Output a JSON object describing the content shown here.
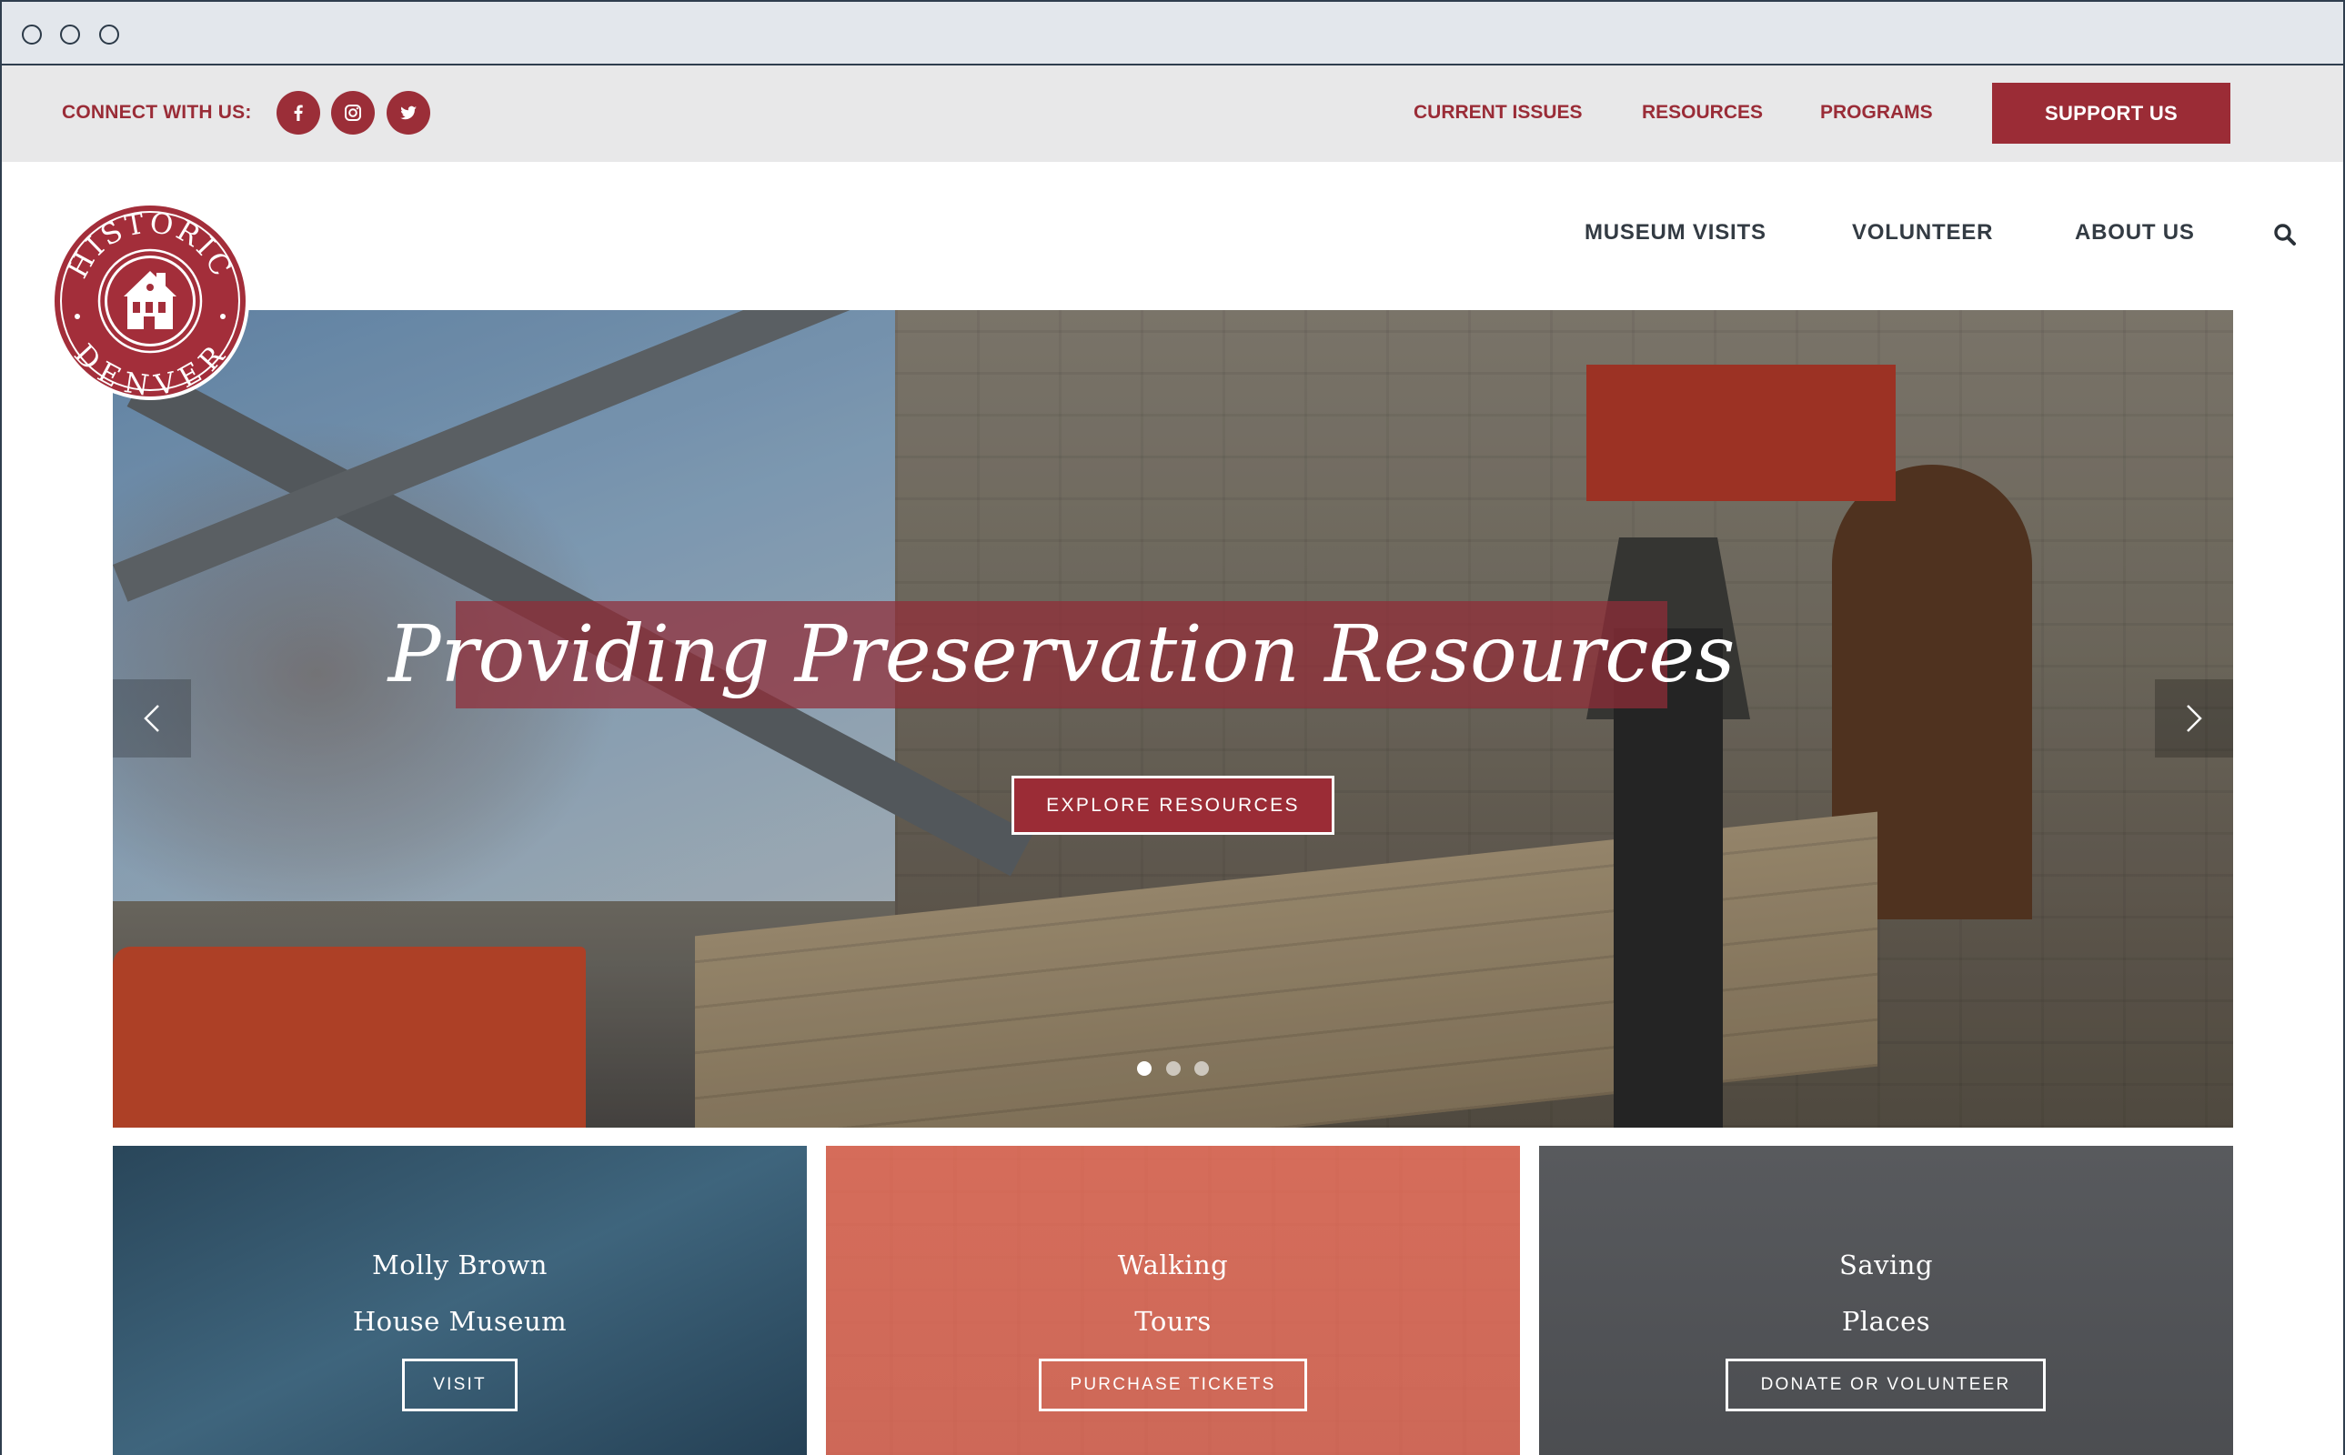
{
  "window": {
    "controls": [
      "close",
      "minimize",
      "maximize"
    ]
  },
  "topbar": {
    "connect_label": "CONNECT WITH US:",
    "social": [
      {
        "name": "facebook-icon"
      },
      {
        "name": "instagram-icon"
      },
      {
        "name": "twitter-icon"
      }
    ],
    "links": {
      "current_issues": "CURRENT ISSUES",
      "resources": "RESOURCES",
      "programs": "PROGRAMS"
    },
    "support_label": "SUPPORT US"
  },
  "logo": {
    "line1": "HISTORIC",
    "line2": "DENVER"
  },
  "nav": {
    "museum_visits": "MUSEUM VISITS",
    "volunteer": "VOLUNTEER",
    "about_us": "ABOUT US",
    "search_icon": "search-icon"
  },
  "hero": {
    "title": "Providing Preservation Resources",
    "button": "EXPLORE RESOURCES",
    "slides": 3,
    "active_slide": 1
  },
  "cards": [
    {
      "title_line1": "Molly Brown",
      "title_line2": "House Museum",
      "button": "VISIT",
      "color": "#1d4a66"
    },
    {
      "title_line1": "Walking",
      "title_line2": "Tours",
      "button": "PURCHASE TICKETS",
      "color": "#cf5c48"
    },
    {
      "title_line1": "Saving",
      "title_line2": "Places",
      "button": "DONATE OR VOLUNTEER",
      "color": "#4c4e52"
    }
  ],
  "colors": {
    "brand_red": "#9b2c36",
    "topbar_bg": "#e8e8e9",
    "nav_text": "#333b43"
  }
}
